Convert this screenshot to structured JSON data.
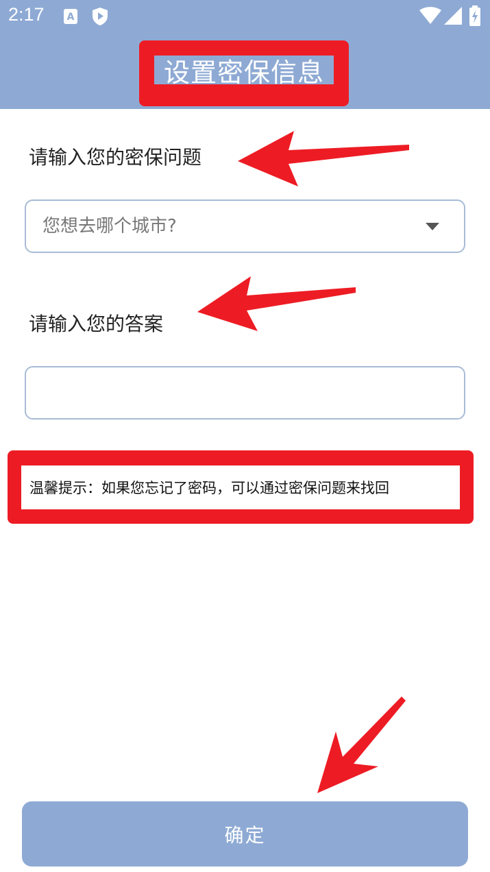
{
  "status_bar": {
    "time": "2:17",
    "icons": [
      "font-a-icon",
      "shield-play-icon",
      "wifi-icon",
      "signal-icon",
      "battery-charging-icon"
    ]
  },
  "header": {
    "title": "设置密保信息"
  },
  "form": {
    "question_label": "请输入您的密保问题",
    "question_select_value": "您想去哪个城市?",
    "answer_label": "请输入您的答案",
    "answer_value": ""
  },
  "tip": {
    "text": "温馨提示：如果您忘记了密码，可以通过密保问题来找回"
  },
  "actions": {
    "confirm_label": "确定"
  },
  "colors": {
    "primary": "#8eaad4",
    "annotation_red": "#ed1c24",
    "field_border": "#a7bbd6"
  }
}
